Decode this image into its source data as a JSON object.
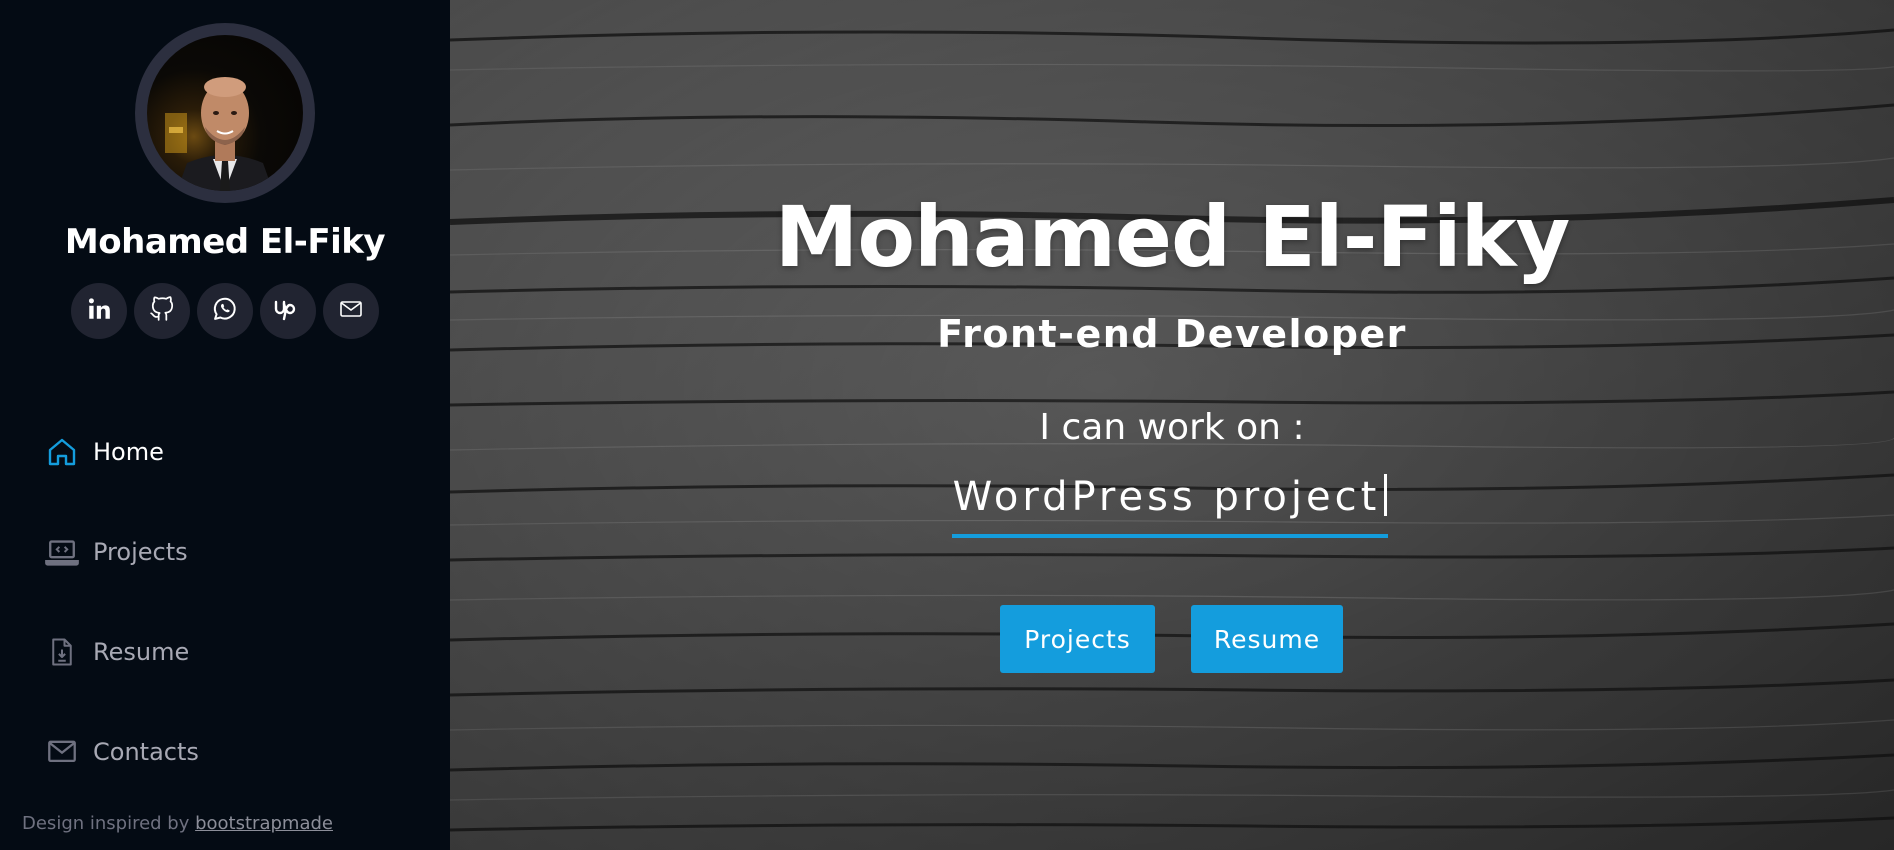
{
  "profile": {
    "name": "Mohamed El-Fiky"
  },
  "socials": [
    {
      "icon": "linkedin-icon"
    },
    {
      "icon": "github-icon"
    },
    {
      "icon": "whatsapp-icon"
    },
    {
      "icon": "upwork-icon"
    },
    {
      "icon": "mail-icon"
    }
  ],
  "nav": {
    "items": [
      {
        "label": "Home",
        "icon": "home-icon",
        "active": true
      },
      {
        "label": "Projects",
        "icon": "laptop-code-icon",
        "active": false
      },
      {
        "label": "Resume",
        "icon": "file-download-icon",
        "active": false
      },
      {
        "label": "Contacts",
        "icon": "envelope-icon",
        "active": false
      }
    ]
  },
  "footer": {
    "prefix": "Design inspired by ",
    "link": "bootstrapmade"
  },
  "hero": {
    "title": "Mohamed El-Fiky",
    "subtitle": "Front-end Developer",
    "work_label": "I can work on :",
    "typed": "WordPress project",
    "buttons": {
      "projects": "Projects",
      "resume": "Resume"
    }
  },
  "colors": {
    "accent": "#149ddd",
    "sidebar_bg": "#040b14",
    "social_bg": "#212431"
  }
}
